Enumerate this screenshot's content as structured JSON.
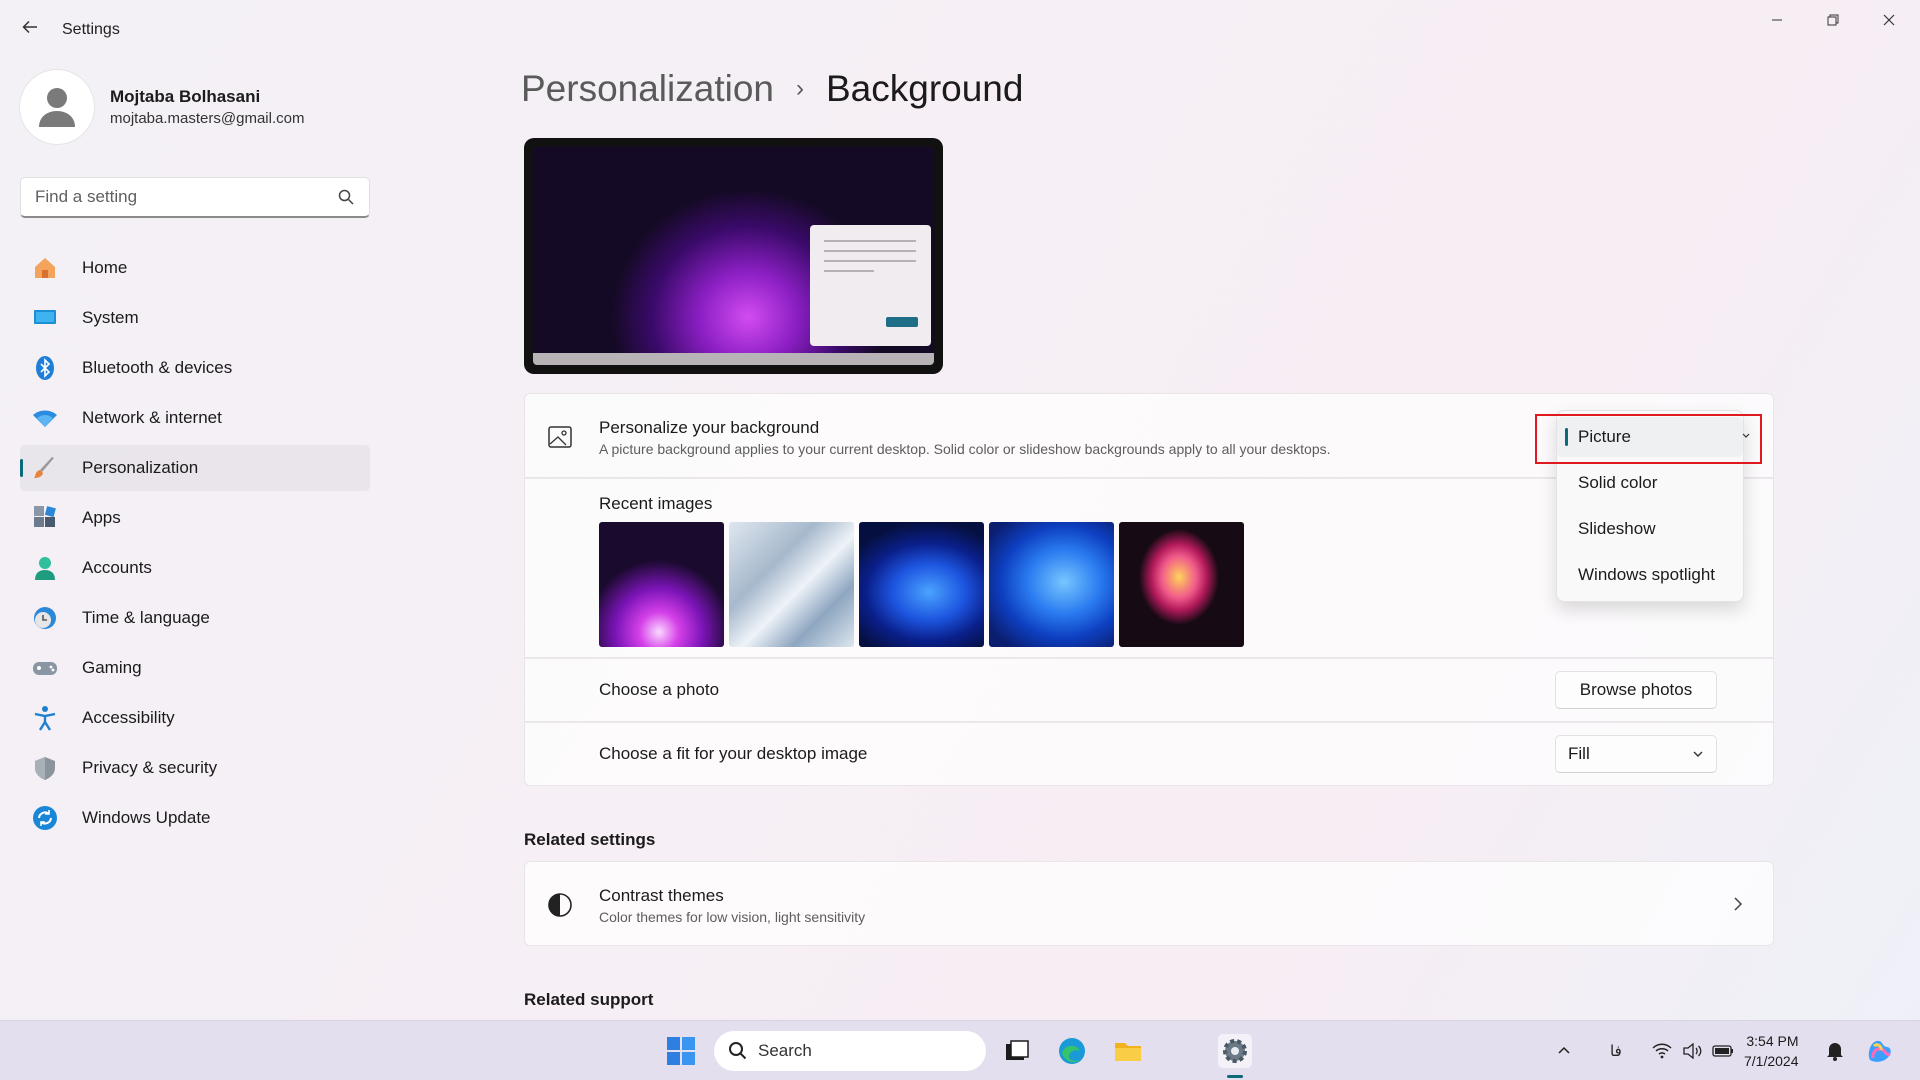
{
  "window": {
    "title": "Settings",
    "back_icon": "arrow-left-icon",
    "controls": [
      "minimize-icon",
      "restore-icon",
      "close-icon"
    ]
  },
  "profile": {
    "name": "Mojtaba Bolhasani",
    "email": "mojtaba.masters@gmail.com"
  },
  "search": {
    "placeholder": "Find a setting"
  },
  "sidebar": {
    "items": [
      {
        "label": "Home",
        "icon": "home-icon"
      },
      {
        "label": "System",
        "icon": "monitor-icon"
      },
      {
        "label": "Bluetooth & devices",
        "icon": "bluetooth-icon"
      },
      {
        "label": "Network & internet",
        "icon": "wifi-icon"
      },
      {
        "label": "Personalization",
        "icon": "brush-icon",
        "active": true
      },
      {
        "label": "Apps",
        "icon": "apps-icon"
      },
      {
        "label": "Accounts",
        "icon": "person-icon"
      },
      {
        "label": "Time & language",
        "icon": "clock-globe-icon"
      },
      {
        "label": "Gaming",
        "icon": "gamepad-icon"
      },
      {
        "label": "Accessibility",
        "icon": "accessibility-icon"
      },
      {
        "label": "Privacy & security",
        "icon": "shield-icon"
      },
      {
        "label": "Windows Update",
        "icon": "sync-icon"
      }
    ]
  },
  "breadcrumb": {
    "parent": "Personalization",
    "separator": "›",
    "current": "Background"
  },
  "personalize": {
    "title": "Personalize your background",
    "subtitle": "A picture background applies to your current desktop. Solid color or slideshow backgrounds apply to all your desktops.",
    "selected": "Picture",
    "options": [
      "Picture",
      "Solid color",
      "Slideshow",
      "Windows spotlight"
    ]
  },
  "recent_images": {
    "title": "Recent images",
    "count": 5
  },
  "choose_photo": {
    "title": "Choose a photo",
    "button": "Browse photos"
  },
  "fit": {
    "title": "Choose a fit for your desktop image",
    "value": "Fill"
  },
  "related_settings": {
    "heading": "Related settings",
    "contrast_title": "Contrast themes",
    "contrast_subtitle": "Color themes for low vision, light sensitivity"
  },
  "related_support": {
    "heading": "Related support"
  },
  "taskbar": {
    "search_label": "Search",
    "language": "فا",
    "time": "3:54 PM",
    "date": "7/1/2024"
  },
  "colors": {
    "accent": "#0b6a7a",
    "highlight": "#e0181f"
  }
}
